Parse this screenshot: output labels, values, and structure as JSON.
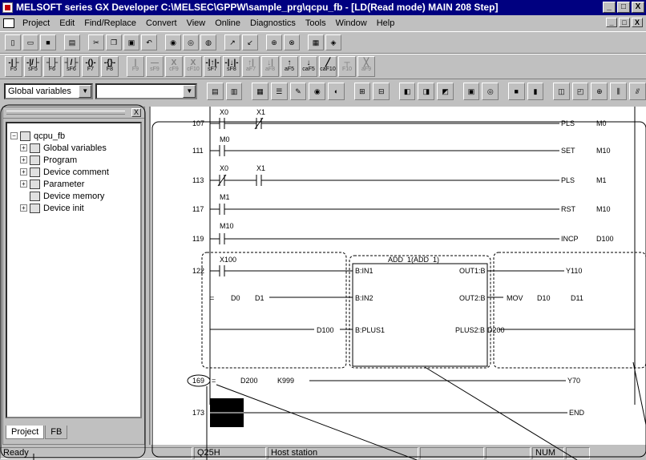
{
  "window": {
    "title": "MELSOFT series GX Developer C:\\MELSEC\\GPPW\\sample_prg\\qcpu_fb - [LD(Read mode)    MAIN    208 Step]",
    "minimize": "_",
    "maximize": "□",
    "close": "X"
  },
  "menu": {
    "items": [
      "Project",
      "Edit",
      "Find/Replace",
      "Convert",
      "View",
      "Online",
      "Diagnostics",
      "Tools",
      "Window",
      "Help"
    ]
  },
  "toolbar2": {
    "buttons": [
      {
        "sym": "-|├",
        "key": "F5"
      },
      {
        "sym": "-|/├",
        "key": "sF5"
      },
      {
        "sym": "┤├",
        "key": "F6"
      },
      {
        "sym": "┤/├",
        "key": "sF6"
      },
      {
        "sym": "-()-",
        "key": "F7"
      },
      {
        "sym": "-{}-",
        "key": "F8"
      },
      {
        "sym": "|",
        "key": "F9"
      },
      {
        "sym": "—",
        "key": "sF9"
      },
      {
        "sym": "X",
        "key": "cF9"
      },
      {
        "sym": "X",
        "key": "cF10"
      },
      {
        "sym": "-|↑|-",
        "key": "sF7"
      },
      {
        "sym": "-|↓|-",
        "key": "sF8"
      },
      {
        "sym": "↑|",
        "key": "aF7"
      },
      {
        "sym": "↓|",
        "key": "aF8"
      },
      {
        "sym": "↑",
        "key": "aF5"
      },
      {
        "sym": "↓",
        "key": "caF5"
      },
      {
        "sym": "╱",
        "key": "caF10"
      },
      {
        "sym": "┬",
        "key": "F10"
      },
      {
        "sym": "╳",
        "key": "aF9"
      }
    ]
  },
  "toolbar3": {
    "scope_select": "Global variables",
    "device_select": ""
  },
  "project_panel": {
    "close": "X",
    "root": "qcpu_fb",
    "items": [
      {
        "label": "Global variables",
        "expand": "+"
      },
      {
        "label": "Program",
        "expand": "+"
      },
      {
        "label": "Device comment",
        "expand": "+"
      },
      {
        "label": "Parameter",
        "expand": "+"
      },
      {
        "label": "Device memory",
        "expand": ""
      },
      {
        "label": "Device init",
        "expand": "+"
      }
    ],
    "tabs": [
      "Project",
      "FB"
    ]
  },
  "ladder": {
    "rungs": {
      "r107": {
        "step": "107",
        "c1": "X0",
        "c2": "X1",
        "instr": "PLS",
        "op": "M0"
      },
      "r111": {
        "step": "111",
        "c1": "M0",
        "instr": "SET",
        "op": "M10"
      },
      "r113": {
        "step": "113",
        "c1": "X0",
        "c2": "X1",
        "instr": "PLS",
        "op": "M1"
      },
      "r117": {
        "step": "117",
        "c1": "M1",
        "instr": "RST",
        "op": "M10"
      },
      "r119": {
        "step": "119",
        "c1": "M10",
        "instr": "INCP",
        "op": "D100"
      },
      "r122": {
        "step": "122",
        "c1": "X100",
        "fb_name": "ADD_1(ADD_1)",
        "in1": "B:IN1",
        "in2": "B:IN2",
        "plus1": "B:PLUS1",
        "out1": "OUT1:B",
        "out2": "OUT2:B",
        "plus2": "PLUS2:B",
        "cmp": "=",
        "cmp_a": "D0",
        "cmp_b": "D1",
        "plus1_dev": "D100",
        "out1_dev": "Y110",
        "mov": "MOV",
        "mov_a": "D10",
        "mov_b": "D11",
        "plus2_dev": "D200"
      },
      "r169": {
        "step": "169",
        "cmp": "=",
        "a": "D200",
        "b": "K999",
        "coil": "Y70"
      },
      "r173": {
        "step": "173",
        "instr": "END"
      }
    }
  },
  "statusbar": {
    "ready": "Ready",
    "cpu": "Q25H",
    "station": "Host station",
    "num": "NUM"
  }
}
